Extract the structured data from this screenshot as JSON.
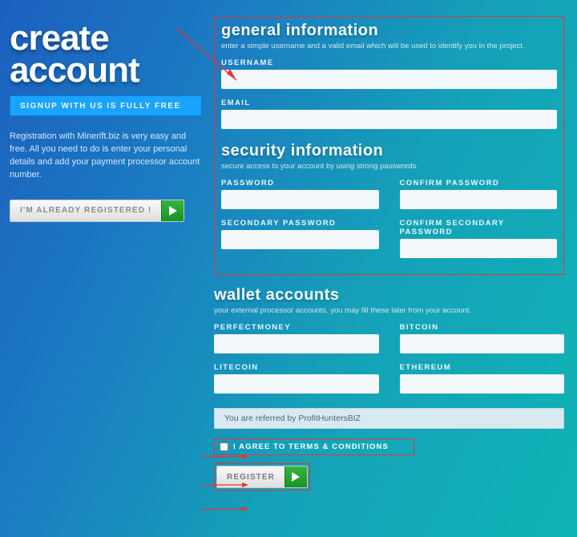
{
  "title_l1": "create",
  "title_l2": "account",
  "chip": "SIGNUP WITH US IS FULLY FREE",
  "intro": "Registration with Minerift.biz is very easy and free. All you need to do is enter your personal details and add your payment processor account number.",
  "already_btn": "I'M ALREADY REGISTERED !",
  "general": {
    "title": "general information",
    "sub": "enter a simple username and a valid email which will be used to identify you in the project.",
    "username_label": "USERNAME",
    "email_label": "EMAIL"
  },
  "security": {
    "title": "security information",
    "sub": "secure access to your account by using strong passwords.",
    "password_label": "PASSWORD",
    "confirm_password_label": "CONFIRM PASSWORD",
    "secondary_label": "SECONDARY PASSWORD",
    "confirm_secondary_label": "CONFIRM SECONDARY PASSWORD"
  },
  "wallet": {
    "title": "wallet accounts",
    "sub": "your external processor accounts. you may fill these later from your account.",
    "pm": "PERFECTMONEY",
    "btc": "BITCOIN",
    "ltc": "LITECOIN",
    "eth": "ETHEREUM"
  },
  "referral": "You are referred by ProfitHuntersBIZ",
  "terms_label": "I AGREE TO TERMS & CONDITIONS",
  "register_btn": "REGISTER"
}
